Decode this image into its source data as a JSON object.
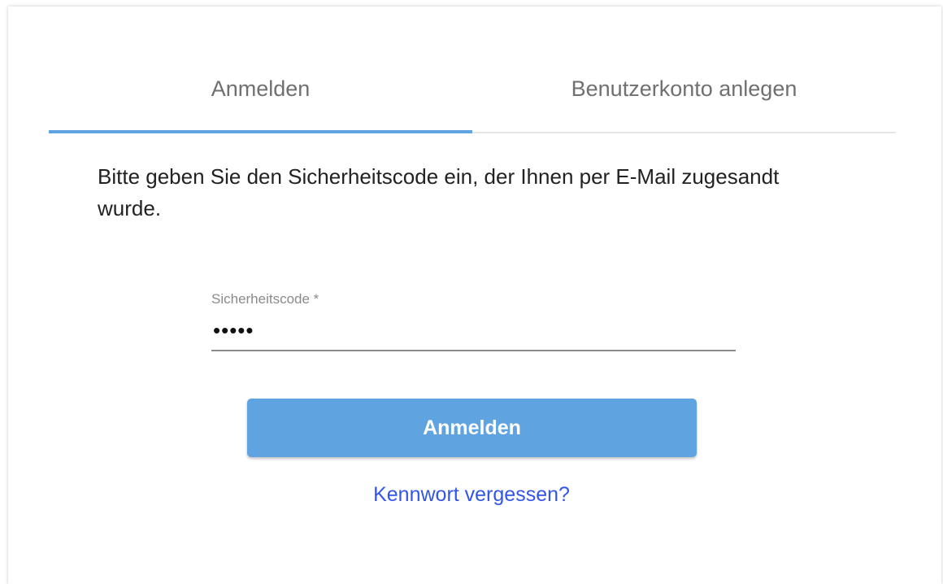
{
  "tabs": [
    {
      "label": "Anmelden",
      "active": true
    },
    {
      "label": "Benutzerkonto anlegen",
      "active": false
    }
  ],
  "message": "Bitte geben Sie den Sicherheitscode ein, der Ihnen per E-Mail zugesandt wurde.",
  "form": {
    "code_label": "Sicherheitscode *",
    "code_value": "•••••",
    "submit_label": "Anmelden",
    "forgot_label": "Kennwort vergessen?"
  },
  "colors": {
    "accent": "#5fa3e0",
    "link": "#3355e8"
  }
}
